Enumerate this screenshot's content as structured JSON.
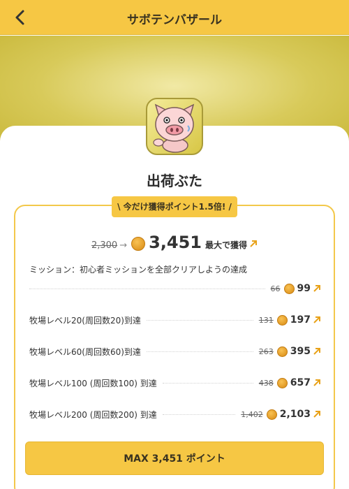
{
  "header": {
    "title": "サボテンバザール"
  },
  "app": {
    "name": "出荷ぶた"
  },
  "promo": {
    "badge_text": "今だけ獲得ポイント1.5倍!"
  },
  "total": {
    "old_value": "2,300",
    "new_value": "3,451",
    "suffix": "最大で獲得"
  },
  "mission": {
    "text": "ミッション：初心者ミッションを全部クリアしようの達成",
    "old_points": "66",
    "new_points": "99"
  },
  "rewards": [
    {
      "label": "牧場レベル20(周回数20)到達",
      "old_points": "131",
      "new_points": "197"
    },
    {
      "label": "牧場レベル60(周回数60)到達",
      "old_points": "263",
      "new_points": "395"
    },
    {
      "label": "牧場レベル100 (周回数100) 到達",
      "old_points": "438",
      "new_points": "657"
    },
    {
      "label": "牧場レベル200 (周回数200) 到達",
      "old_points": "1,402",
      "new_points": "2,103"
    }
  ],
  "cta": {
    "label": "MAX 3,451 ポイント"
  },
  "colors": {
    "accent": "#f6c744",
    "arrow": "#e8a21a",
    "coin": "#e8a21a"
  }
}
